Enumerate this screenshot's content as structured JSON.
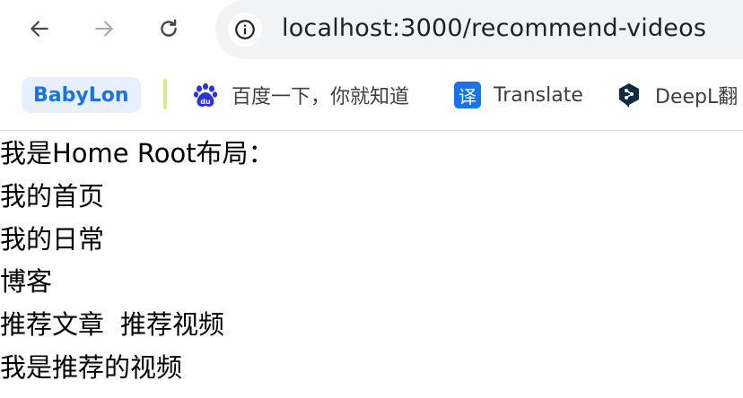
{
  "toolbar": {
    "back_icon": "arrow-left-icon",
    "forward_icon": "arrow-right-icon",
    "reload_icon": "reload-icon",
    "site_info_icon": "info-circle-icon",
    "url": "localhost:3000/recommend-videos"
  },
  "bookmarks": [
    {
      "label": "BabyLon",
      "icon": "none"
    },
    {
      "label": "百度一下，你就知道",
      "icon": "baidu-paw-icon"
    },
    {
      "label": "Translate",
      "icon": "translate-icon",
      "icon_text": "译"
    },
    {
      "label": "DeepL翻",
      "icon": "deepl-icon"
    }
  ],
  "page": {
    "lines": [
      "我是Home Root布局：",
      "我的首页",
      "我的日常",
      "博客"
    ],
    "nav_links": [
      "推荐文章",
      "推荐视频"
    ],
    "recommend_text": "我是推荐的视频"
  },
  "colors": {
    "omnibox_bg": "#f1f3f4",
    "babylon_bg": "#e8f0fe",
    "babylon_text": "#1a73e8",
    "separator": "#d6e98a",
    "translate_icon_bg": "#1a73e8",
    "deepl_icon": "#0f2b46"
  }
}
